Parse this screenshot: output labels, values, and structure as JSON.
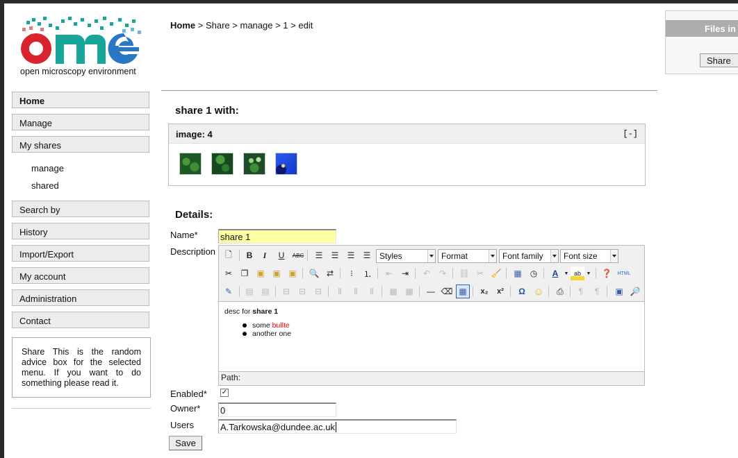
{
  "logo": {
    "caption": "open microscopy environment",
    "colors": {
      "red": "#d9232e",
      "teal": "#1aa59a",
      "blue": "#2a78c4"
    }
  },
  "menu": {
    "home": "Home",
    "manage": "Manage",
    "my_shares": "My shares",
    "sub_manage": "manage",
    "sub_shared": "shared",
    "search_by": "Search by",
    "history": "History",
    "import_export": "Import/Export",
    "my_account": "My account",
    "administration": "Administration",
    "contact": "Contact"
  },
  "advice": "Share This is the random advice box for the selected menu. If you want to do something please read it.",
  "breadcrumb": {
    "home": "Home",
    "sep": " > ",
    "share": "Share",
    "manage": "manage",
    "id": "1",
    "edit": "edit"
  },
  "share_heading": "share 1 with:",
  "image_box": {
    "title": "image: 4",
    "toggle": "[-]",
    "thumb_colors": [
      "#1c5a24",
      "#154a1e",
      "#1d4c2a",
      "#1636c8"
    ]
  },
  "details_heading": "Details:",
  "form": {
    "name_label": "Name*",
    "name_value": "share 1",
    "description_label": "Description",
    "enabled_label": "Enabled*",
    "enabled_checked": "✓",
    "owner_label": "Owner*",
    "owner_value": "0",
    "users_label": "Users",
    "users_value": "A.Tarkowska@dundee.ac.uk",
    "save_label": "Save"
  },
  "editor": {
    "styles": "Styles",
    "format": "Format",
    "font_family": "Font family",
    "font_size": "Font size",
    "html_label": "HTML",
    "content_prefix": "desc for ",
    "content_bold": "share 1",
    "bullet1_prefix": "some ",
    "bullet1_red": "bullte",
    "bullet2": "another one",
    "path_label": "Path:"
  },
  "right_panel": {
    "title": "Files in",
    "button": "Share"
  }
}
